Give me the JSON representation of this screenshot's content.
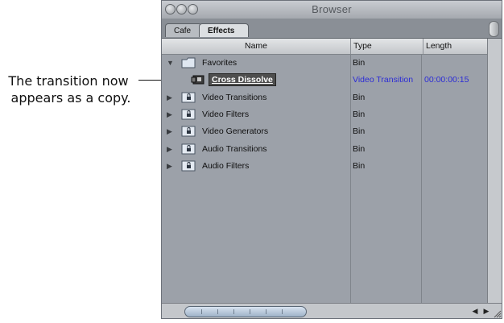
{
  "annotation": {
    "line1": "The transition now",
    "line2": "appears as a copy."
  },
  "window": {
    "title": "Browser"
  },
  "tabs": [
    {
      "label": "Cafe",
      "active": false
    },
    {
      "label": "Effects",
      "active": true
    }
  ],
  "columns": {
    "name": "Name",
    "type": "Type",
    "length": "Length"
  },
  "rows": [
    {
      "label": "Favorites",
      "type": "Bin",
      "length": "",
      "expanded": true,
      "icon": "folder-icon"
    },
    {
      "label": "Cross Dissolve",
      "type": "Video Transition",
      "length": "00:00:00:15",
      "selected": true,
      "icon": "transition-clip-icon"
    },
    {
      "label": "Video Transitions",
      "type": "Bin",
      "length": "",
      "icon": "locked-bin-icon"
    },
    {
      "label": "Video Filters",
      "type": "Bin",
      "length": "",
      "icon": "locked-bin-icon"
    },
    {
      "label": "Video Generators",
      "type": "Bin",
      "length": "",
      "icon": "locked-bin-icon"
    },
    {
      "label": "Audio Transitions",
      "type": "Bin",
      "length": "",
      "icon": "locked-bin-icon"
    },
    {
      "label": "Audio Filters",
      "type": "Bin",
      "length": "",
      "icon": "locked-bin-icon"
    }
  ],
  "colors": {
    "selection_bg": "#4e4e4e",
    "transition_text": "#2c2cd6",
    "window_bg": "#9ca1a9"
  }
}
